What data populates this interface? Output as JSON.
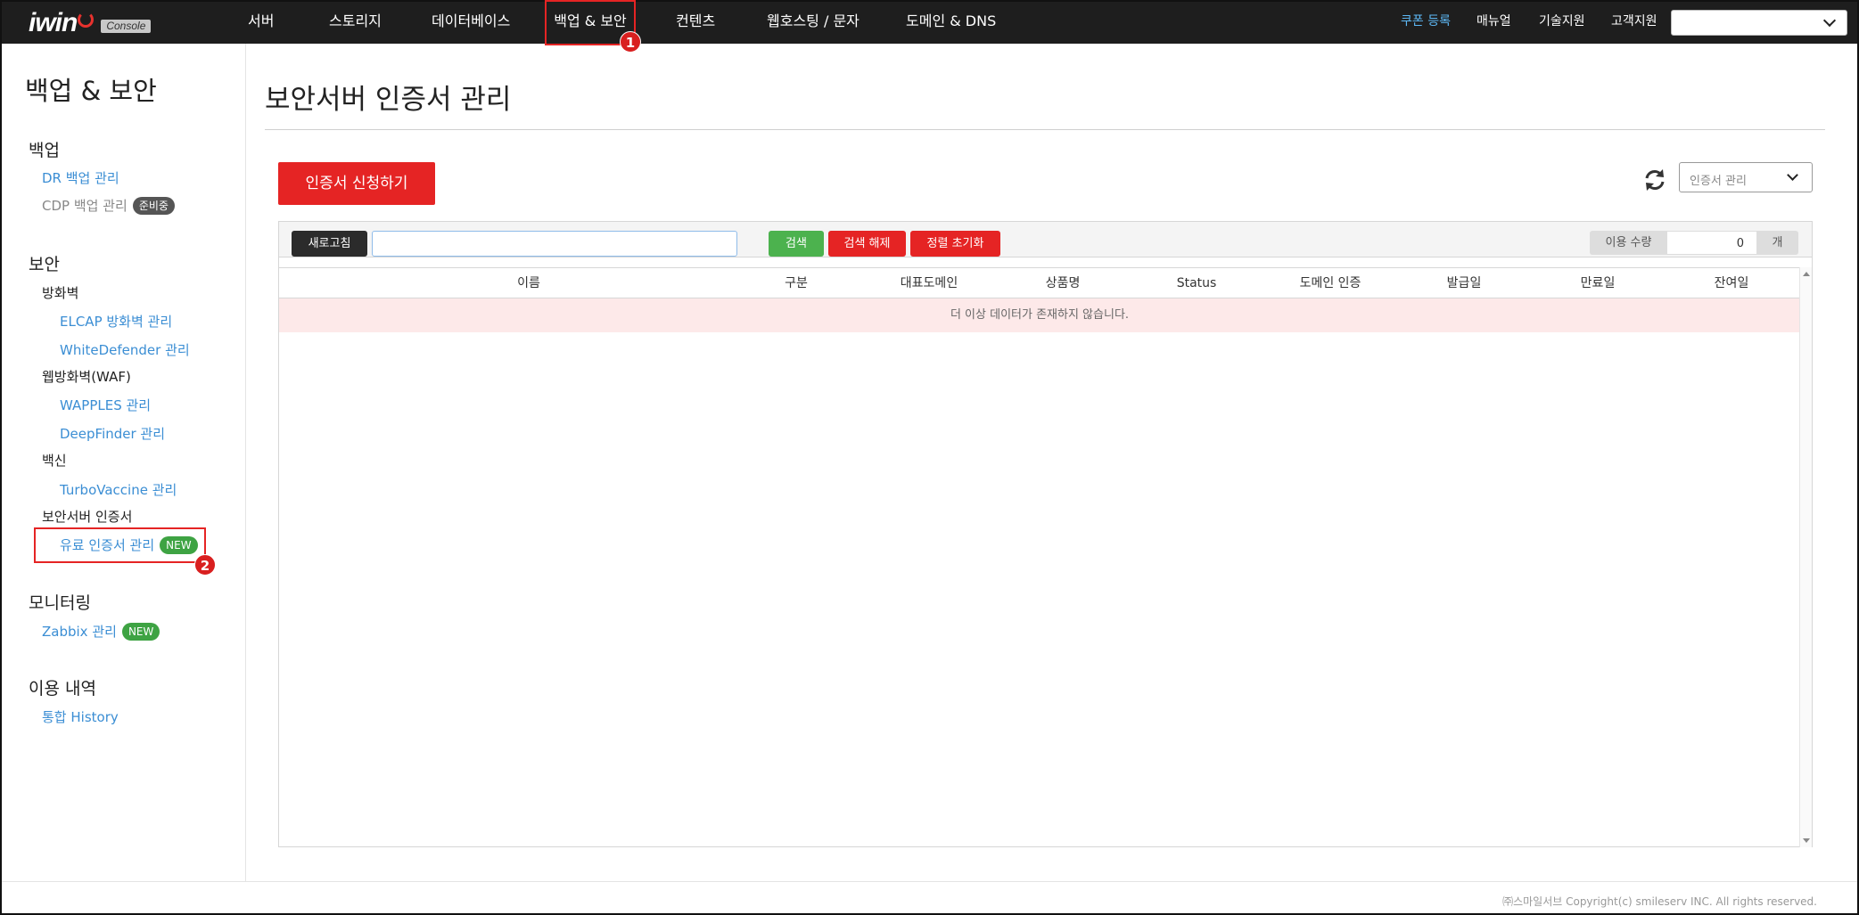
{
  "brand": {
    "logo_text": "iwin",
    "logo_badge": "Console"
  },
  "topnav": {
    "items": [
      "서버",
      "스토리지",
      "데이터베이스",
      "백업 & 보안",
      "컨텐츠",
      "웹호스팅 / 문자",
      "도메인 & DNS"
    ],
    "active_index": 3,
    "right_items": [
      "쿠폰 등록",
      "매뉴얼",
      "기술지원",
      "고객지원"
    ],
    "account_select_value": ""
  },
  "steps": [
    "1",
    "2"
  ],
  "sidebar": {
    "title": "백업 & 보안",
    "sections": {
      "backup": {
        "label": "백업",
        "links": [
          "DR 백업 관리",
          "CDP 백업 관리"
        ],
        "cdp_badge": "준비중"
      },
      "security": {
        "label": "보안",
        "firewall": {
          "label": "방화벽",
          "links": [
            "ELCAP 방화벽 관리",
            "WhiteDefender 관리"
          ]
        },
        "waf": {
          "label": "웹방화벽(WAF)",
          "links": [
            "WAPPLES 관리",
            "DeepFinder 관리"
          ]
        },
        "vaccine": {
          "label": "백신",
          "links": [
            "TurboVaccine 관리"
          ]
        },
        "ssl": {
          "label": "보안서버 인증서",
          "links": [
            "유료 인증서 관리"
          ],
          "badge": "NEW"
        }
      },
      "monitoring": {
        "label": "모니터링",
        "links": [
          "Zabbix 관리"
        ],
        "badge": "NEW"
      },
      "usage": {
        "label": "이용 내역",
        "links": [
          "통합 History"
        ]
      }
    }
  },
  "main": {
    "page_title": "보안서버 인증서 관리",
    "apply_button": "인증서 신청하기",
    "view_select": "인증서 관리",
    "toolbar": {
      "refresh": "새로고침",
      "search_value": "",
      "search_placeholder": "",
      "search": "검색",
      "clear": "검색 해제",
      "reset_sort": "정렬 초기화",
      "usage_label": "이용 수량",
      "usage_value": "0",
      "usage_unit": "개"
    },
    "table": {
      "columns": [
        "이름",
        "구분",
        "대표도메인",
        "상품명",
        "Status",
        "도메인 인증",
        "발급일",
        "만료일",
        "잔여일"
      ],
      "empty_message": "더 이상 데이터가 존재하지 않습니다."
    }
  },
  "footer": {
    "copyright": "㈜스마일서브 Copyright(c) smileserv INC. All rights reserved."
  },
  "colors": {
    "accent_red": "#e52424",
    "green": "#4cb24e",
    "link_blue": "#3b8ed4",
    "nav_bg": "#1e1e1e"
  }
}
